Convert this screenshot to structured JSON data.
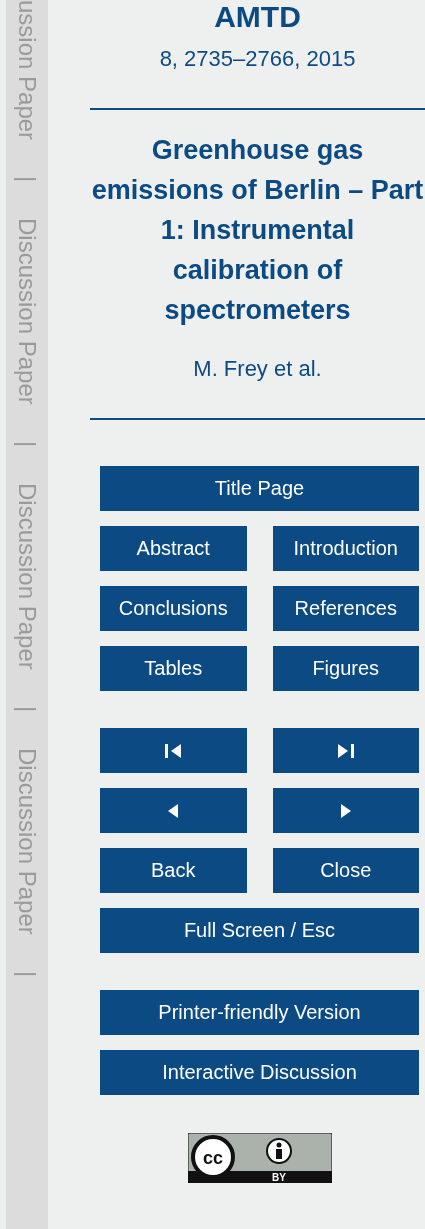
{
  "side_strip": [
    "ussion Paper",
    "|",
    "Discussion Paper",
    "|",
    "Discussion Paper",
    "|",
    "Discussion Paper",
    "|"
  ],
  "journal": "AMTD",
  "citation": "8, 2735–2766, 2015",
  "title": "Greenhouse gas emissions of Berlin – Part 1: Instrumental calibration of spectrometers",
  "authors": "M. Frey et al.",
  "button_groups": [
    {
      "rows": [
        [
          {
            "kind": "text",
            "label": "Title Page"
          }
        ],
        [
          {
            "kind": "text",
            "label": "Abstract"
          },
          {
            "kind": "text",
            "label": "Introduction"
          }
        ],
        [
          {
            "kind": "text",
            "label": "Conclusions"
          },
          {
            "kind": "text",
            "label": "References"
          }
        ],
        [
          {
            "kind": "text",
            "label": "Tables"
          },
          {
            "kind": "text",
            "label": "Figures"
          }
        ]
      ]
    },
    {
      "rows": [
        [
          {
            "kind": "first"
          },
          {
            "kind": "last"
          }
        ],
        [
          {
            "kind": "prev"
          },
          {
            "kind": "next"
          }
        ],
        [
          {
            "kind": "text",
            "label": "Back"
          },
          {
            "kind": "text",
            "label": "Close"
          }
        ],
        [
          {
            "kind": "text",
            "label": "Full Screen / Esc"
          }
        ]
      ]
    },
    {
      "rows": [
        [
          {
            "kind": "text",
            "label": "Printer-friendly Version"
          }
        ],
        [
          {
            "kind": "text",
            "label": "Interactive Discussion"
          }
        ]
      ]
    }
  ],
  "license_badge": {
    "symbol": "cc",
    "label": "BY"
  }
}
